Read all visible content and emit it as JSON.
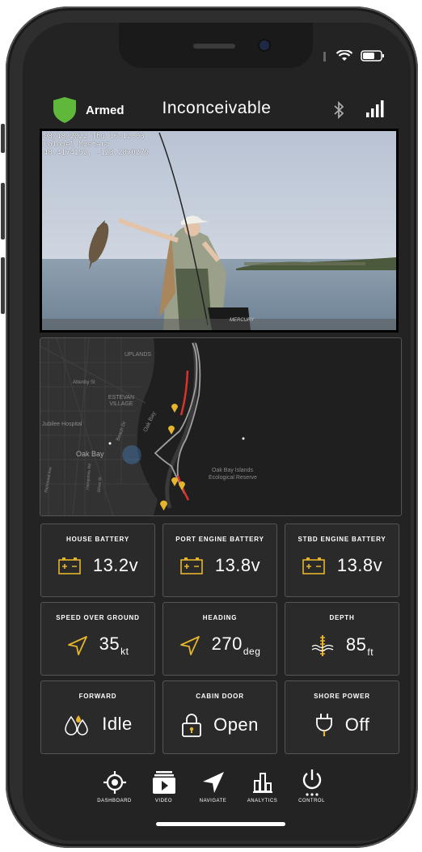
{
  "header": {
    "status_label": "Armed",
    "vessel_name": "Inconceivable"
  },
  "video": {
    "overlay_line1": "08/18/2022 Thu 16:12:03",
    "overlay_line2": "Colonel Mustard",
    "overlay_line3": "48.4174152, -123.2870279",
    "engine_brand": "MERCURY"
  },
  "map": {
    "labels": [
      "UPLANDS",
      "Attenby St",
      "ESTEVAN VILLAGE",
      "Jubilee Hospital",
      "Oak Bay",
      "Oak Bay Islands",
      "Ecological Reserve",
      "Beach Dr",
      "Oak Bay",
      "Richmond Ave",
      "Hampshire Rd",
      "Oliver St"
    ]
  },
  "tiles": [
    {
      "title": "HOUSE BATTERY",
      "value": "13.2v",
      "unit": "",
      "icon": "battery-icon"
    },
    {
      "title": "PORT ENGINE BATTERY",
      "value": "13.8v",
      "unit": "",
      "icon": "battery-icon"
    },
    {
      "title": "STBD ENGINE BATTERY",
      "value": "13.8v",
      "unit": "",
      "icon": "battery-icon"
    },
    {
      "title": "SPEED OVER GROUND",
      "value": "35",
      "unit": "kt",
      "icon": "navigation-arrow-icon"
    },
    {
      "title": "HEADING",
      "value": "270",
      "unit": "deg",
      "icon": "navigation-arrow-icon"
    },
    {
      "title": "DEPTH",
      "value": "85",
      "unit": "ft",
      "icon": "depth-gauge-icon"
    },
    {
      "title": "FORWARD",
      "value": "Idle",
      "unit": "",
      "icon": "bilge-drops-icon"
    },
    {
      "title": "CABIN DOOR",
      "value": "Open",
      "unit": "",
      "icon": "padlock-icon"
    },
    {
      "title": "SHORE POWER",
      "value": "Off",
      "unit": "",
      "icon": "plug-icon"
    }
  ],
  "nav": [
    {
      "label": "DASHBOARD",
      "icon": "crosshair-icon"
    },
    {
      "label": "VIDEO",
      "icon": "video-icon"
    },
    {
      "label": "NAVIGATE",
      "icon": "navigate-arrow-icon"
    },
    {
      "label": "ANALYTICS",
      "icon": "bar-chart-icon"
    },
    {
      "label": "CONTROL",
      "icon": "power-icon"
    }
  ],
  "colors": {
    "accent": "#E6B52C",
    "shield": "#5FB83A",
    "track_red": "#D9342B"
  }
}
